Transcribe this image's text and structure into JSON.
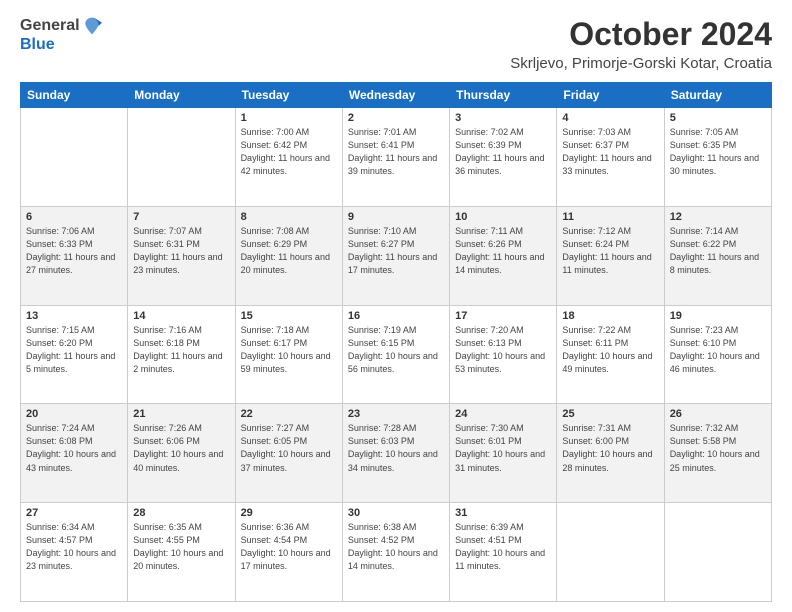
{
  "header": {
    "logo": {
      "general": "General",
      "blue": "Blue"
    },
    "title": "October 2024",
    "location": "Skrljevo, Primorje-Gorski Kotar, Croatia"
  },
  "days_of_week": [
    "Sunday",
    "Monday",
    "Tuesday",
    "Wednesday",
    "Thursday",
    "Friday",
    "Saturday"
  ],
  "weeks": [
    [
      {
        "day": "",
        "info": ""
      },
      {
        "day": "",
        "info": ""
      },
      {
        "day": "1",
        "info": "Sunrise: 7:00 AM\nSunset: 6:42 PM\nDaylight: 11 hours and 42 minutes."
      },
      {
        "day": "2",
        "info": "Sunrise: 7:01 AM\nSunset: 6:41 PM\nDaylight: 11 hours and 39 minutes."
      },
      {
        "day": "3",
        "info": "Sunrise: 7:02 AM\nSunset: 6:39 PM\nDaylight: 11 hours and 36 minutes."
      },
      {
        "day": "4",
        "info": "Sunrise: 7:03 AM\nSunset: 6:37 PM\nDaylight: 11 hours and 33 minutes."
      },
      {
        "day": "5",
        "info": "Sunrise: 7:05 AM\nSunset: 6:35 PM\nDaylight: 11 hours and 30 minutes."
      }
    ],
    [
      {
        "day": "6",
        "info": "Sunrise: 7:06 AM\nSunset: 6:33 PM\nDaylight: 11 hours and 27 minutes."
      },
      {
        "day": "7",
        "info": "Sunrise: 7:07 AM\nSunset: 6:31 PM\nDaylight: 11 hours and 23 minutes."
      },
      {
        "day": "8",
        "info": "Sunrise: 7:08 AM\nSunset: 6:29 PM\nDaylight: 11 hours and 20 minutes."
      },
      {
        "day": "9",
        "info": "Sunrise: 7:10 AM\nSunset: 6:27 PM\nDaylight: 11 hours and 17 minutes."
      },
      {
        "day": "10",
        "info": "Sunrise: 7:11 AM\nSunset: 6:26 PM\nDaylight: 11 hours and 14 minutes."
      },
      {
        "day": "11",
        "info": "Sunrise: 7:12 AM\nSunset: 6:24 PM\nDaylight: 11 hours and 11 minutes."
      },
      {
        "day": "12",
        "info": "Sunrise: 7:14 AM\nSunset: 6:22 PM\nDaylight: 11 hours and 8 minutes."
      }
    ],
    [
      {
        "day": "13",
        "info": "Sunrise: 7:15 AM\nSunset: 6:20 PM\nDaylight: 11 hours and 5 minutes."
      },
      {
        "day": "14",
        "info": "Sunrise: 7:16 AM\nSunset: 6:18 PM\nDaylight: 11 hours and 2 minutes."
      },
      {
        "day": "15",
        "info": "Sunrise: 7:18 AM\nSunset: 6:17 PM\nDaylight: 10 hours and 59 minutes."
      },
      {
        "day": "16",
        "info": "Sunrise: 7:19 AM\nSunset: 6:15 PM\nDaylight: 10 hours and 56 minutes."
      },
      {
        "day": "17",
        "info": "Sunrise: 7:20 AM\nSunset: 6:13 PM\nDaylight: 10 hours and 53 minutes."
      },
      {
        "day": "18",
        "info": "Sunrise: 7:22 AM\nSunset: 6:11 PM\nDaylight: 10 hours and 49 minutes."
      },
      {
        "day": "19",
        "info": "Sunrise: 7:23 AM\nSunset: 6:10 PM\nDaylight: 10 hours and 46 minutes."
      }
    ],
    [
      {
        "day": "20",
        "info": "Sunrise: 7:24 AM\nSunset: 6:08 PM\nDaylight: 10 hours and 43 minutes."
      },
      {
        "day": "21",
        "info": "Sunrise: 7:26 AM\nSunset: 6:06 PM\nDaylight: 10 hours and 40 minutes."
      },
      {
        "day": "22",
        "info": "Sunrise: 7:27 AM\nSunset: 6:05 PM\nDaylight: 10 hours and 37 minutes."
      },
      {
        "day": "23",
        "info": "Sunrise: 7:28 AM\nSunset: 6:03 PM\nDaylight: 10 hours and 34 minutes."
      },
      {
        "day": "24",
        "info": "Sunrise: 7:30 AM\nSunset: 6:01 PM\nDaylight: 10 hours and 31 minutes."
      },
      {
        "day": "25",
        "info": "Sunrise: 7:31 AM\nSunset: 6:00 PM\nDaylight: 10 hours and 28 minutes."
      },
      {
        "day": "26",
        "info": "Sunrise: 7:32 AM\nSunset: 5:58 PM\nDaylight: 10 hours and 25 minutes."
      }
    ],
    [
      {
        "day": "27",
        "info": "Sunrise: 6:34 AM\nSunset: 4:57 PM\nDaylight: 10 hours and 23 minutes."
      },
      {
        "day": "28",
        "info": "Sunrise: 6:35 AM\nSunset: 4:55 PM\nDaylight: 10 hours and 20 minutes."
      },
      {
        "day": "29",
        "info": "Sunrise: 6:36 AM\nSunset: 4:54 PM\nDaylight: 10 hours and 17 minutes."
      },
      {
        "day": "30",
        "info": "Sunrise: 6:38 AM\nSunset: 4:52 PM\nDaylight: 10 hours and 14 minutes."
      },
      {
        "day": "31",
        "info": "Sunrise: 6:39 AM\nSunset: 4:51 PM\nDaylight: 10 hours and 11 minutes."
      },
      {
        "day": "",
        "info": ""
      },
      {
        "day": "",
        "info": ""
      }
    ]
  ]
}
